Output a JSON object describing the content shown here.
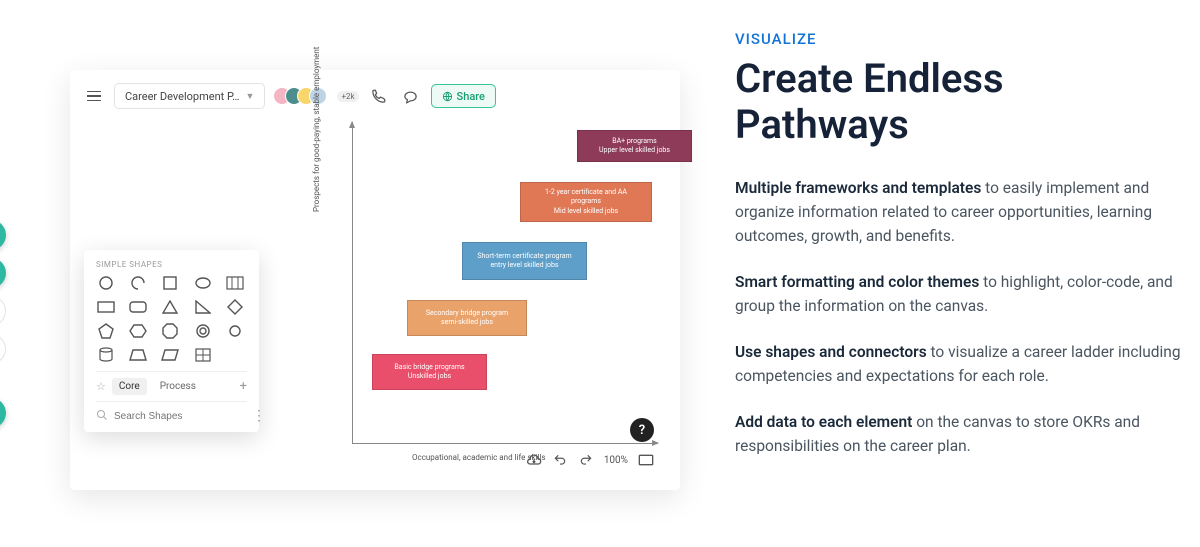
{
  "marketing": {
    "eyebrow": "VISUALIZE",
    "headline": "Create Endless Pathways",
    "paragraphs": [
      {
        "bold": "Multiple frameworks and templates",
        "rest": " to easily implement and organize information related to career opportunities, learning outcomes, growth, and benefits."
      },
      {
        "bold": "Smart formatting and color themes",
        "rest": " to highlight, color-code, and group the information on the canvas."
      },
      {
        "bold": "Use shapes and connectors",
        "rest": " to visualize a career ladder including competencies and expectations for each role."
      },
      {
        "bold": "Add data to each element",
        "rest": " on the canvas to store OKRs and responsibilities on the career plan."
      }
    ]
  },
  "app": {
    "file_name": "Career Development P…",
    "avatar_extra": "+2k",
    "share_label": "Share",
    "zoom": "100%",
    "y_axis_label": "Prospects   for  good-paying,   stable   employment",
    "x_axis_label": "Occupational,    academic   and   life  skills",
    "steps": {
      "s5": {
        "l1": "BA+  programs",
        "l2": "Upper  level   skilled   jobs"
      },
      "s4": {
        "l1": "1-2   year   certificate    and   AA",
        "l2": "programs",
        "l3": "Mid   level   skilled   jobs"
      },
      "s3": {
        "l1": "Short-term   certificate   program",
        "l2": "entry   level  skilled   jobs"
      },
      "s2": {
        "l1": "Secondary   bridge   program",
        "l2": "semi-skilled    jobs"
      },
      "s1": {
        "l1": "Basic  bridge   programs",
        "l2": "Unskilled   jobs"
      }
    }
  },
  "palette": {
    "title": "SIMPLE SHAPES",
    "tab_core": "Core",
    "tab_process": "Process",
    "search_placeholder": "Search Shapes"
  }
}
